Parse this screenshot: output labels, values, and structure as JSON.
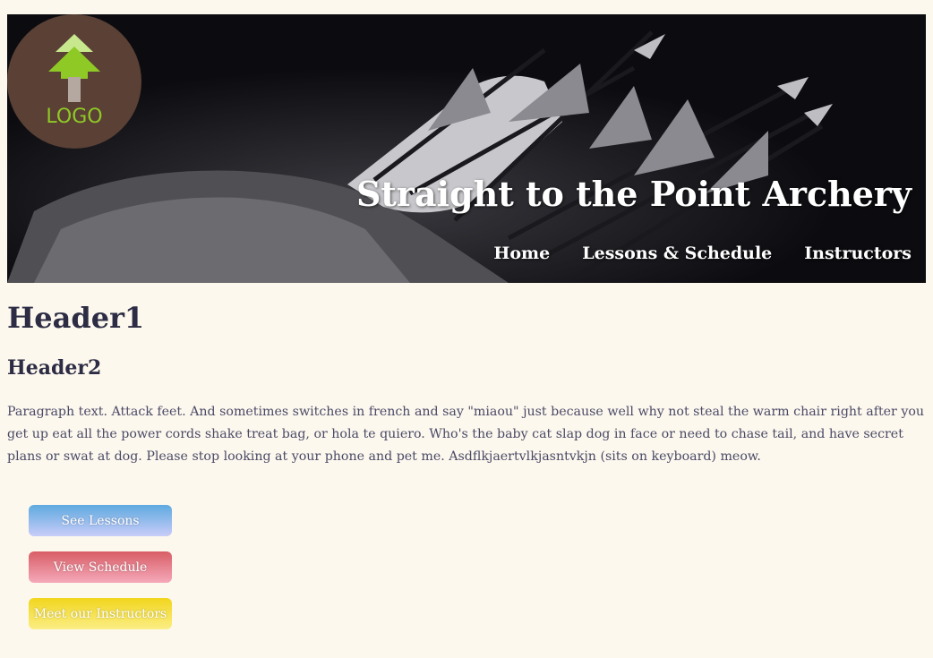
{
  "logo": {
    "text": "LOGO",
    "icon": "arrow-up-icon"
  },
  "header": {
    "title": "Straight to the Point Archery",
    "nav": [
      "Home",
      "Lessons & Schedule",
      "Instructors"
    ]
  },
  "main": {
    "h1": "Header1",
    "h2": "Header2",
    "paragraph": "Paragraph text. Attack feet. And sometimes switches in french and say \"miaou\" just because well why not steal the warm chair right after you get up eat all the power cords shake treat bag, or hola te quiero. Who's the baby cat slap dog in face or need to chase tail, and have secret plans or swat at dog. Please stop looking at your phone and pet me. Asdflkjaertvlkjasntvkjn (sits on keyboard) meow.",
    "buttons": [
      "See Lessons",
      "View Schedule",
      "Meet our Instructors"
    ]
  },
  "colors": {
    "background": "#fdf8ee",
    "heading": "#2c2c44",
    "logo_circle": "#5a4035",
    "logo_green": "#8fc926"
  }
}
